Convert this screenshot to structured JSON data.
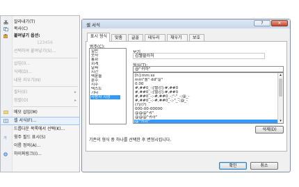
{
  "context_menu": {
    "items": [
      {
        "label": "잘라내기(T)",
        "icon": "scissors-icon"
      },
      {
        "label": "복사(C)",
        "icon": "copy-icon"
      },
      {
        "label": "붙여넣기 옵션:",
        "icon": "paste-icon"
      },
      {
        "label": "선택하여 붙여넣기(S)...",
        "disabled": true
      },
      {
        "label": "삽입(I)...",
        "disabled": true
      },
      {
        "label": "삭제(D)...",
        "disabled": true
      },
      {
        "label": "내용 지우기(N)",
        "disabled": true
      },
      {
        "label": "필터(E)",
        "disabled": true
      },
      {
        "label": "정렬(O)",
        "disabled": true
      },
      {
        "label": "메모 삽입(M)",
        "icon": "comment-icon"
      },
      {
        "label": "셀 서식(F)...",
        "icon": "cells-icon"
      },
      {
        "label": "드롭다운 목록에서 선택(K)..."
      },
      {
        "label": "윗주 필드 표시(S)",
        "icon": "phonetic-icon"
      },
      {
        "label": "이름 정의(A)..."
      },
      {
        "label": "하이퍼링크(I)...",
        "icon": "hyperlink-icon"
      }
    ],
    "ghost_text": "123456"
  },
  "dialog": {
    "title": "셀 서식",
    "help_label": "?",
    "close_label": "✕",
    "tabs": [
      "표시 형식",
      "맞춤",
      "글꼴",
      "테두리",
      "채우기",
      "보호"
    ],
    "category_label": "범주(C):",
    "categories": [
      "일반",
      "숫자",
      "통화",
      "회계",
      "날짜",
      "시간",
      "백분율",
      "분수",
      "지수",
      "텍스트",
      "기타",
      "사용자 지정"
    ],
    "selected_category": "사용자 지정",
    "sample_label": "보기",
    "sample_value": "김웰쥘러허",
    "type_label": "형식(T):",
    "type_value": "@\"귀하\"",
    "formats": [
      "[h]:mm:ss",
      "mm\"월\" dd\"일\"",
      "0.00",
      "#,##0_-;[빨강]-#,##0",
      "#,##0_-;[빨강]-#,##0",
      "#,##0_-;-#,##0_-;\"-\"_-;@_-",
      "#,##0_-;-#,##0_-;-\"_-;@_-",
      "(?)/(?)",
      "000-00-00000",
      "@@@\"귀\"",
      "@@@\"귀하\"",
      "@\"귀하\""
    ],
    "selected_format": "@\"귀하\"",
    "delete_label": "삭제(D)",
    "description": "기존의 형식 중 하나를 선택한 후 변형시킵니다.",
    "ok_label": "확인",
    "cancel_label": "취소"
  }
}
